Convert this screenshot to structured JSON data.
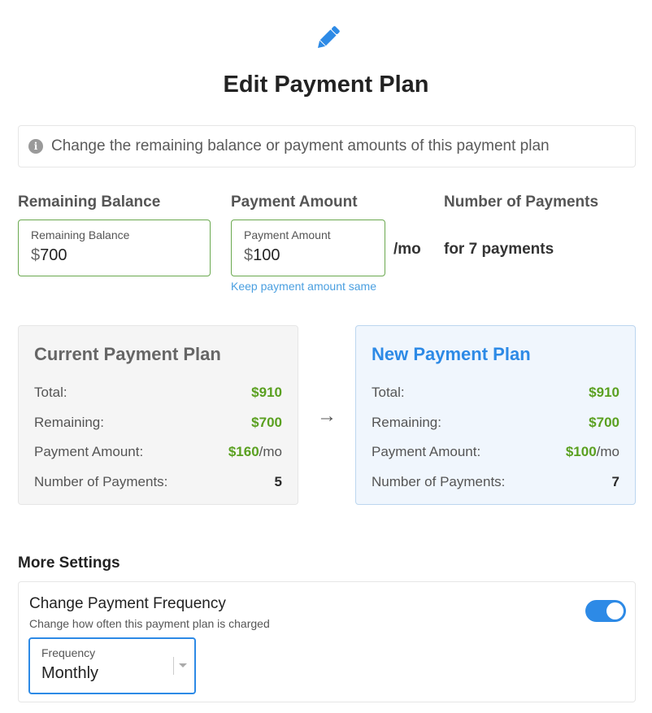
{
  "header": {
    "icon": "pencil-icon",
    "title": "Edit Payment Plan"
  },
  "info": {
    "icon": "info-icon",
    "text": "Change the remaining balance or payment amounts of this payment plan"
  },
  "columns": {
    "remaining_balance": {
      "heading": "Remaining Balance",
      "field_label": "Remaining Balance",
      "currency": "$",
      "value": "700"
    },
    "payment_amount": {
      "heading": "Payment Amount",
      "field_label": "Payment Amount",
      "currency": "$",
      "value": "100",
      "suffix": "/mo",
      "keep_link": "Keep payment amount same"
    },
    "number_of_payments": {
      "heading": "Number of Payments",
      "text": "for 7 payments"
    }
  },
  "current_plan": {
    "title": "Current Payment Plan",
    "rows": [
      {
        "label": "Total:",
        "value": "$910"
      },
      {
        "label": "Remaining:",
        "value": "$700"
      },
      {
        "label": "Payment Amount:",
        "value": "$160",
        "unit": "/mo"
      },
      {
        "label": "Number of Payments:",
        "value": "5"
      }
    ]
  },
  "arrow": "→",
  "new_plan": {
    "title": "New Payment Plan",
    "rows": [
      {
        "label": "Total:",
        "value": "$910"
      },
      {
        "label": "Remaining:",
        "value": "$700"
      },
      {
        "label": "Payment Amount:",
        "value": "$100",
        "unit": "/mo"
      },
      {
        "label": "Number of Payments:",
        "value": "7"
      }
    ]
  },
  "more_settings": {
    "heading": "More Settings",
    "frequency": {
      "title": "Change Payment Frequency",
      "subtitle": "Change how often this payment plan is charged",
      "toggle_on": true,
      "select_label": "Frequency",
      "select_value": "Monthly"
    }
  },
  "colors": {
    "accent": "#2d8ae6",
    "green": "#5aa020",
    "field_border": "#6aa84f"
  }
}
